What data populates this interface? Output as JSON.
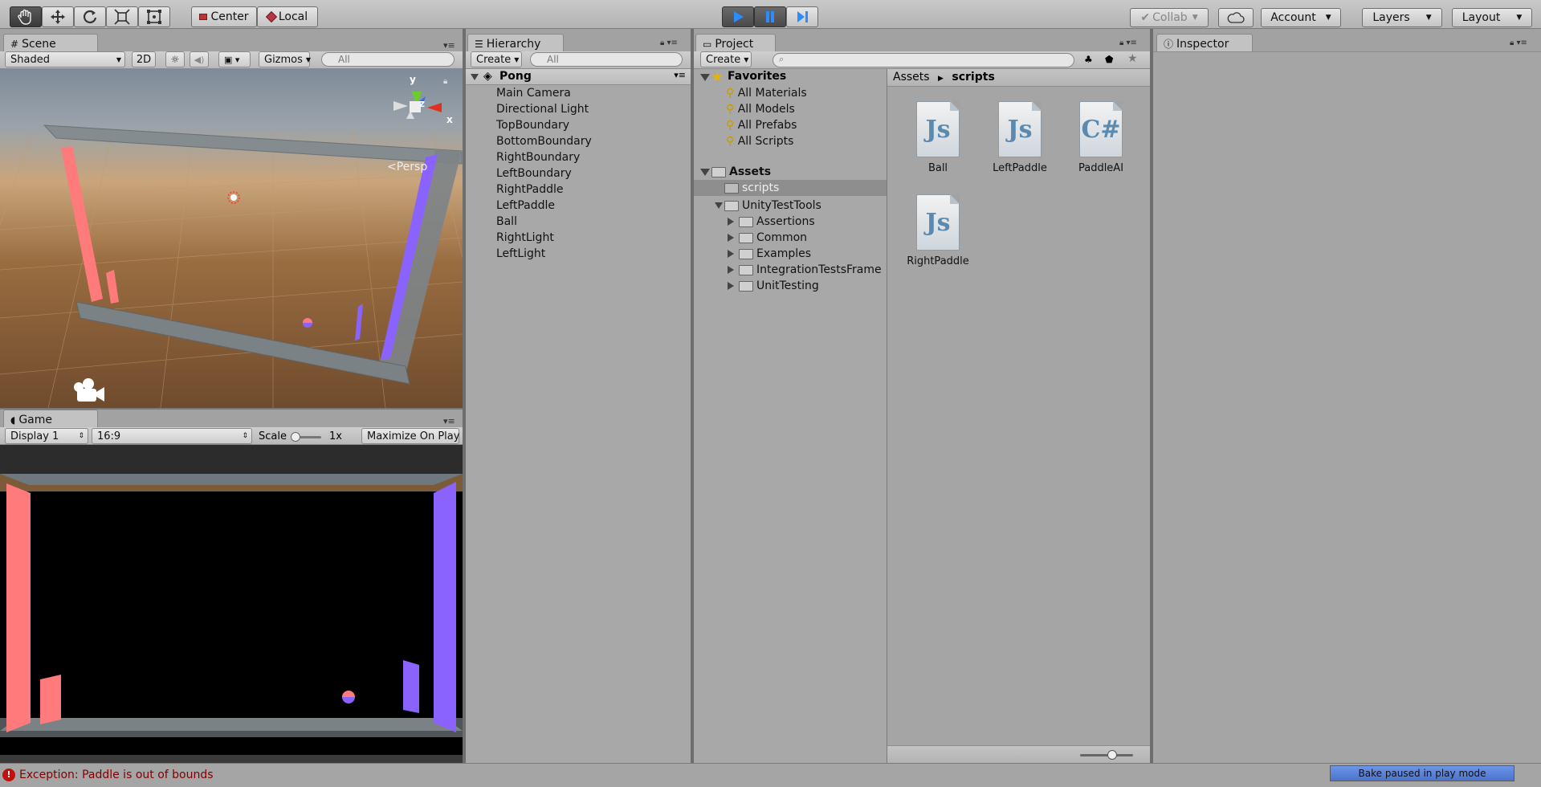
{
  "toolbar": {
    "pivot_label": "Center",
    "space_label": "Local",
    "collab_label": "Collab",
    "account_label": "Account",
    "layers_label": "Layers",
    "layout_label": "Layout",
    "accent": "#2a8cff"
  },
  "scene": {
    "tab": "Scene",
    "shading": "Shaded",
    "mode2d": "2D",
    "gizmos": "Gizmos",
    "search_placeholder": "All",
    "persp": "Persp",
    "axes": {
      "y": "y",
      "z": "z",
      "x": "x"
    },
    "paddle_colors": {
      "left": "#ff7b7b",
      "right": "#8a63ff"
    }
  },
  "game": {
    "tab": "Game",
    "display": "Display 1",
    "aspect": "16:9",
    "scale_label": "Scale",
    "scale_value": "1x",
    "maximize": "Maximize On Play"
  },
  "hierarchy": {
    "tab": "Hierarchy",
    "create": "Create",
    "search_placeholder": "All",
    "scene_name": "Pong",
    "items": [
      "Main Camera",
      "Directional Light",
      "TopBoundary",
      "BottomBoundary",
      "RightBoundary",
      "LeftBoundary",
      "RightPaddle",
      "LeftPaddle",
      "Ball",
      "RightLight",
      "LeftLight"
    ]
  },
  "project": {
    "tab": "Project",
    "create": "Create",
    "favorites_label": "Favorites",
    "favorites": [
      "All Materials",
      "All Models",
      "All Prefabs",
      "All Scripts"
    ],
    "assets_label": "Assets",
    "scripts_folder": "scripts",
    "unity_test_tools": "UnityTestTools",
    "subfolders": [
      "Assertions",
      "Common",
      "Examples",
      "IntegrationTestsFrame",
      "UnitTesting"
    ],
    "breadcrumb": [
      "Assets",
      "scripts"
    ],
    "files": [
      {
        "name": "Ball",
        "type": "Js"
      },
      {
        "name": "LeftPaddle",
        "type": "Js"
      },
      {
        "name": "PaddleAI",
        "type": "C#"
      },
      {
        "name": "RightPaddle",
        "type": "Js"
      }
    ]
  },
  "inspector": {
    "tab": "Inspector"
  },
  "status": {
    "error": "Exception: Paddle is out of bounds",
    "bake": "Bake paused in play mode"
  }
}
